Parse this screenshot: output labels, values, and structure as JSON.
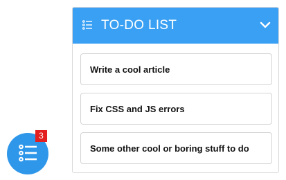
{
  "panel": {
    "title": "TO-DO LIST",
    "header_color": "#3aa0f3",
    "header_icon": "list-icon",
    "collapse_icon": "chevron-down-icon"
  },
  "items": [
    {
      "label": "Write a cool article"
    },
    {
      "label": "Fix CSS and JS errors"
    },
    {
      "label": "Some other cool or boring stuff to do"
    }
  ],
  "fab": {
    "icon": "list-icon",
    "color": "#2f97ea",
    "badge_count": "3",
    "badge_color": "#e41f1f"
  }
}
